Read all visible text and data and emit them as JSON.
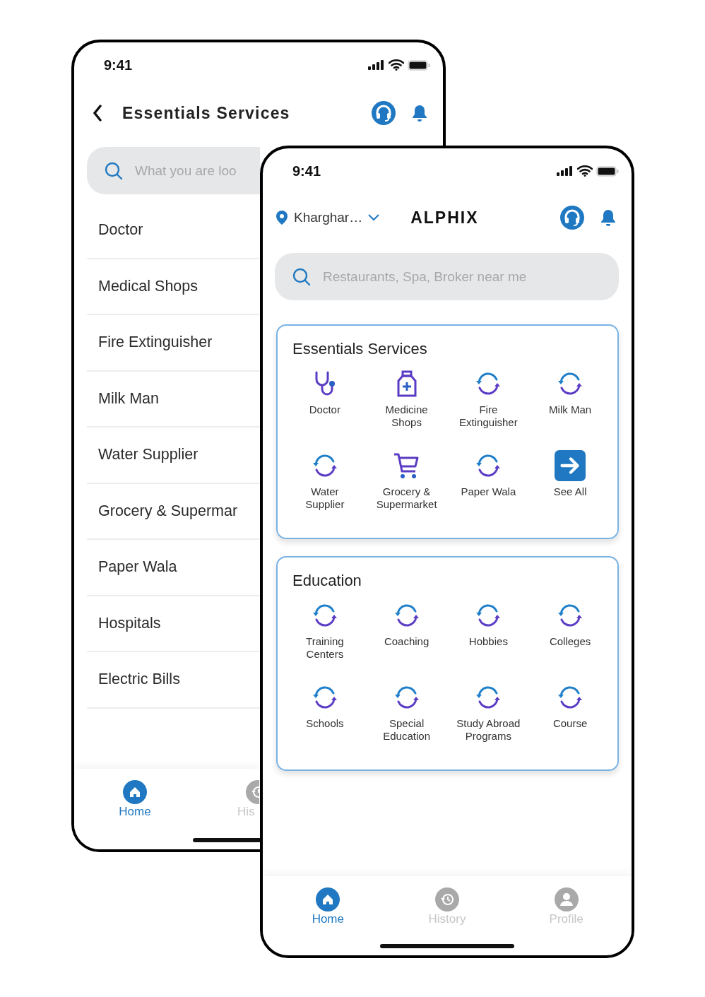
{
  "back_screen": {
    "status_bar": {
      "time": "9:41"
    },
    "header": {
      "title": "Essentials Services"
    },
    "search": {
      "placeholder": "What you are loo"
    },
    "items": [
      "Doctor",
      "Medical Shops",
      "Fire Extinguisher",
      "Milk Man",
      "Water Supplier",
      "Grocery & Supermar",
      "Paper Wala",
      "Hospitals",
      "Electric Bills"
    ],
    "nav": [
      {
        "label": "Home",
        "kind": "home",
        "selected": true
      },
      {
        "label": "His",
        "kind": "history",
        "selected": false
      }
    ]
  },
  "front_screen": {
    "status_bar": {
      "time": "9:41"
    },
    "location": "Kharghar…",
    "brand": "ALPHIX",
    "search": {
      "placeholder": "Restaurants, Spa, Broker near me"
    },
    "sections": [
      {
        "title": "Essentials Services",
        "items": [
          {
            "label": "Doctor",
            "kind": "stethoscope"
          },
          {
            "label": "Medicine Shops",
            "kind": "medicine"
          },
          {
            "label": "Fire Extinguisher",
            "kind": "refresh"
          },
          {
            "label": "Milk Man",
            "kind": "refresh"
          },
          {
            "label": "Water Supplier",
            "kind": "refresh"
          },
          {
            "label": "Grocery & Supermarket",
            "kind": "cart"
          },
          {
            "label": "Paper Wala",
            "kind": "refresh"
          },
          {
            "label": "See All",
            "kind": "arrow"
          }
        ]
      },
      {
        "title": "Education",
        "items": [
          {
            "label": "Training Centers",
            "kind": "refresh"
          },
          {
            "label": "Coaching",
            "kind": "refresh"
          },
          {
            "label": "Hobbies",
            "kind": "refresh"
          },
          {
            "label": "Colleges",
            "kind": "refresh"
          },
          {
            "label": "Schools",
            "kind": "refresh"
          },
          {
            "label": "Special Education",
            "kind": "refresh"
          },
          {
            "label": "Study Abroad Programs",
            "kind": "refresh"
          },
          {
            "label": "Course",
            "kind": "refresh"
          }
        ]
      }
    ],
    "nav": [
      {
        "label": "Home",
        "kind": "home",
        "selected": true
      },
      {
        "label": "History",
        "kind": "history",
        "selected": false
      },
      {
        "label": "Profile",
        "kind": "profile",
        "selected": false
      }
    ]
  }
}
